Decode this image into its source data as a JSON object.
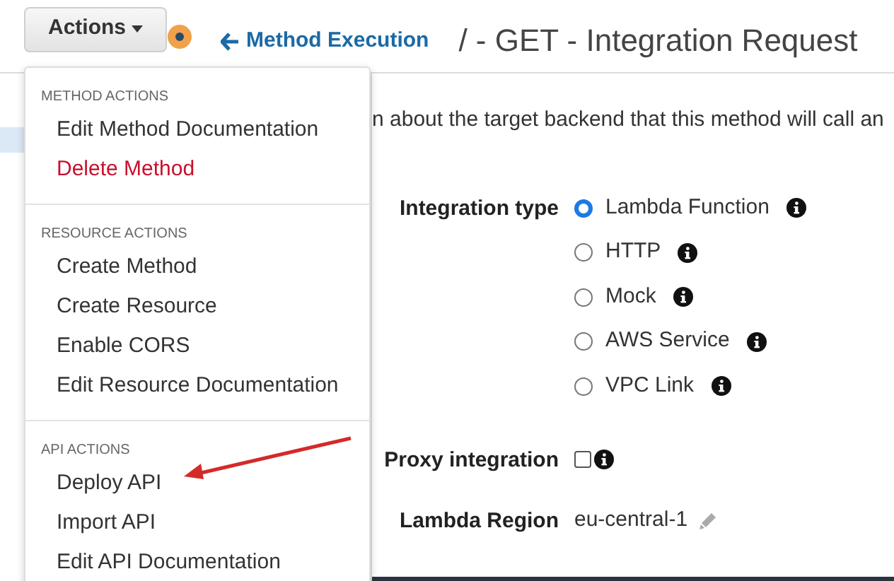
{
  "header": {
    "actions_button": "Actions",
    "back_link": "Method Execution",
    "title": "/ - GET - Integration Request"
  },
  "description": "n about the target backend that this method will call an",
  "menu": {
    "sections": [
      {
        "heading": "METHOD ACTIONS",
        "items": [
          {
            "label": "Edit Method Documentation",
            "kind": "normal"
          },
          {
            "label": "Delete Method",
            "kind": "danger"
          }
        ]
      },
      {
        "heading": "RESOURCE ACTIONS",
        "items": [
          {
            "label": "Create Method",
            "kind": "normal"
          },
          {
            "label": "Create Resource",
            "kind": "normal"
          },
          {
            "label": "Enable CORS",
            "kind": "normal"
          },
          {
            "label": "Edit Resource Documentation",
            "kind": "normal"
          }
        ]
      },
      {
        "heading": "API ACTIONS",
        "items": [
          {
            "label": "Deploy API",
            "kind": "normal"
          },
          {
            "label": "Import API",
            "kind": "normal"
          },
          {
            "label": "Edit API Documentation",
            "kind": "normal"
          }
        ]
      }
    ]
  },
  "form": {
    "integration_type": {
      "label": "Integration type",
      "options": [
        {
          "label": "Lambda Function",
          "selected": true
        },
        {
          "label": "HTTP",
          "selected": false
        },
        {
          "label": "Mock",
          "selected": false
        },
        {
          "label": "AWS Service",
          "selected": false
        },
        {
          "label": "VPC Link",
          "selected": false
        }
      ]
    },
    "proxy": {
      "label": "Proxy integration",
      "checked": false
    },
    "region": {
      "label": "Lambda Region",
      "value": "eu-central-1"
    }
  }
}
